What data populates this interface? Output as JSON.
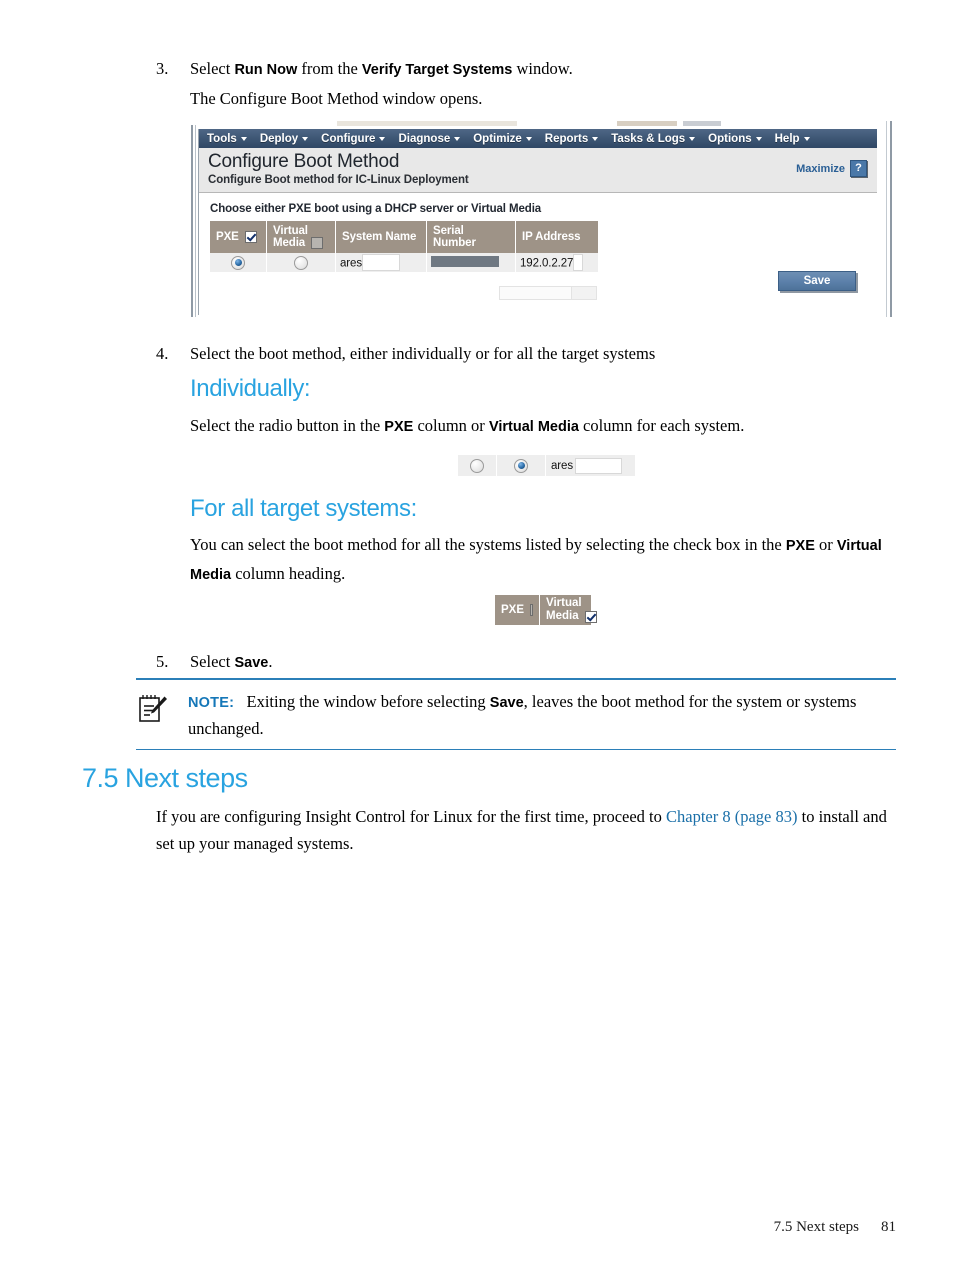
{
  "steps": {
    "step3": {
      "num": "3.",
      "line1_pre": "Select ",
      "line1_b1": "Run Now",
      "line1_mid": " from the ",
      "line1_b2": "Verify Target Systems",
      "line1_post": " window.",
      "line2": "The Configure Boot Method window opens."
    },
    "step4": {
      "num": "4.",
      "text": "Select the boot method, either individually or for all the target systems"
    },
    "step5": {
      "num": "5.",
      "pre": "Select ",
      "bold": "Save",
      "post": "."
    }
  },
  "individually": {
    "heading": "Individually:",
    "body_pre": "Select the radio button in the ",
    "body_b1": "PXE",
    "body_mid": " column or ",
    "body_b2": "Virtual Media",
    "body_post": " column for each system.",
    "figure": {
      "radio_left_selected": false,
      "radio_right_selected": true,
      "system_name": "ares"
    }
  },
  "all_target_systems": {
    "heading": "For all target systems:",
    "body_line1": "You can select the boot method for all the systems listed by selecting the check box in the",
    "body_b1": "PXE",
    "body_mid": " or ",
    "body_b2": "Virtual Media",
    "body_post": " column heading.",
    "figure": {
      "pxe_label": "PXE",
      "pxe_checked": false,
      "virtual_media_label_line1": "Virtual",
      "virtual_media_label_line2": "Media",
      "virtual_media_checked": true
    }
  },
  "note": {
    "label": "NOTE:",
    "text_pre": "Exiting the window before selecting ",
    "bold": "Save",
    "text_post": ", leaves the boot method for the system or systems unchanged."
  },
  "section": {
    "heading": "7.5 Next steps",
    "body_pre": "If you are configuring Insight Control for Linux for the first time, proceed to ",
    "link": "Chapter 8 (page 83)",
    "body_post": " to install and set up your managed systems."
  },
  "footer": {
    "section_label": "7.5 Next steps",
    "page_number": "81"
  },
  "screenshot": {
    "menu": [
      {
        "label": "Tools"
      },
      {
        "label": "Deploy"
      },
      {
        "label": "Configure"
      },
      {
        "label": "Diagnose"
      },
      {
        "label": "Optimize"
      },
      {
        "label": "Reports"
      },
      {
        "label": "Tasks & Logs"
      },
      {
        "label": "Options"
      },
      {
        "label": "Help"
      }
    ],
    "title": "Configure Boot Method",
    "subtitle": "Configure Boot method for IC-Linux Deployment",
    "maximize_label": "Maximize",
    "help_label": "?",
    "instruction": "Choose either PXE boot using a DHCP server or Virtual Media",
    "table": {
      "headers": {
        "pxe": "PXE",
        "pxe_checked": true,
        "virtual_media_line1": "Virtual",
        "virtual_media_line2": "Media",
        "virtual_media_checked": false,
        "system_name": "System Name",
        "serial_number": "Serial Number",
        "ip_address": "IP Address"
      },
      "rows": [
        {
          "pxe_selected": true,
          "virtual_media_selected": false,
          "system_name": "ares",
          "serial_number": "",
          "ip_address": "192.0.2.27"
        }
      ]
    },
    "save_button": "Save",
    "colors": {
      "menubar": "#3f5876",
      "table_header": "#9e9387",
      "save_button": "#5d81ab",
      "link_blue": "#2a5f95"
    }
  },
  "colors": {
    "heading_blue": "#29a3e0",
    "note_blue": "#1577b8",
    "link_blue": "#1a6fa8",
    "rule_blue": "#2b7fb8"
  }
}
